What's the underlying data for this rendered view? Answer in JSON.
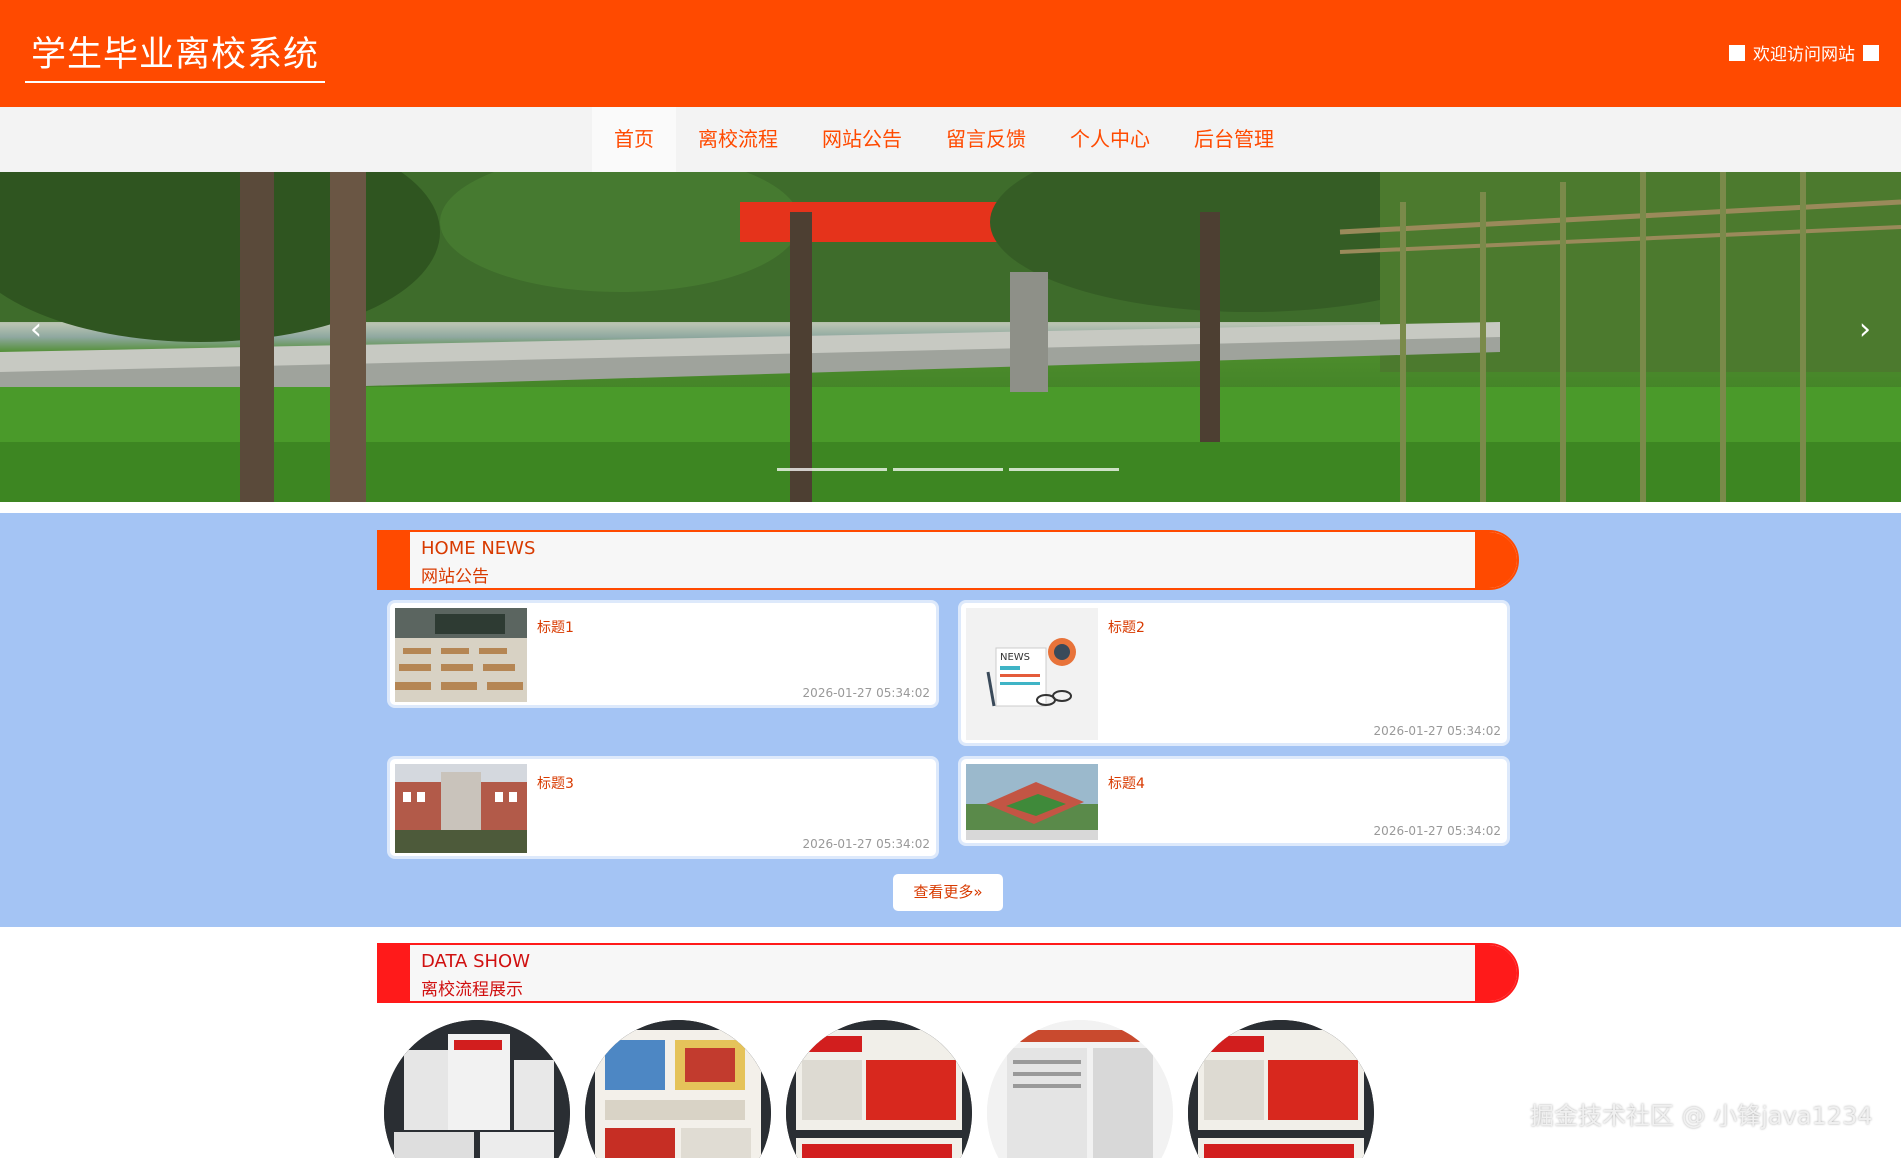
{
  "header": {
    "site_title": "学生毕业离校系统",
    "welcome_text": "欢迎访问网站"
  },
  "nav": {
    "items": [
      {
        "label": "首页",
        "active": true
      },
      {
        "label": "离校流程",
        "active": false
      },
      {
        "label": "网站公告",
        "active": false
      },
      {
        "label": "留言反馈",
        "active": false
      },
      {
        "label": "个人中心",
        "active": false
      },
      {
        "label": "后台管理",
        "active": false
      }
    ]
  },
  "banner": {
    "prev_icon": "‹",
    "next_icon": "›",
    "slide_count": 3
  },
  "news": {
    "heading_en": "HOME NEWS",
    "heading_cn": "网站公告",
    "items": [
      {
        "title": "标题1",
        "time": "2026-01-27 05:34:02",
        "image": "classroom"
      },
      {
        "title": "标题2",
        "time": "2026-01-27 05:34:02",
        "image": "news-graphic"
      },
      {
        "title": "标题3",
        "time": "2026-01-27 05:34:02",
        "image": "campus-building"
      },
      {
        "title": "标题4",
        "time": "2026-01-27 05:34:02",
        "image": "campus-aerial"
      }
    ],
    "more_label": "查看更多",
    "more_icon": "»"
  },
  "data_show": {
    "heading_en": "DATA SHOW",
    "heading_cn": "离校流程展示",
    "items": [
      "newspaper-1",
      "newspaper-2",
      "newspaper-3",
      "newspaper-4",
      "newspaper-5"
    ]
  },
  "watermark": "掘金技术社区 @ 小锋java1234",
  "colors": {
    "brand": "#ff4a00",
    "news_bg": "#a4c4f4",
    "data_accent": "#ff1a1a"
  }
}
